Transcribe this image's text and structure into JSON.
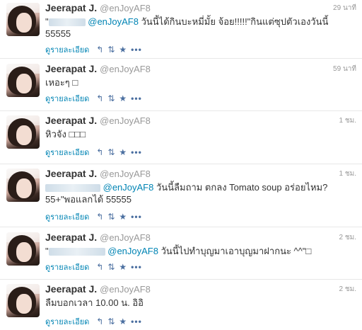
{
  "tweets": [
    {
      "name": "Jeerapat J.",
      "handle": "@enJoyAF8",
      "time": "29 นาที",
      "mention": "@enJoyAF8",
      "text_pre": "\"",
      "text": " วันนี้ได้กินบะหมี่มั้ย จ้อย!!!!!\"กินแต่ซุปตัวเองวันนี้ 55555",
      "details": "ดูรายละเอียด"
    },
    {
      "name": "Jeerapat J.",
      "handle": "@enJoyAF8",
      "time": "59 นาที",
      "text": "เหอะๆ □",
      "details": "ดูรายละเอียด"
    },
    {
      "name": "Jeerapat J.",
      "handle": "@enJoyAF8",
      "time": "1 ชม.",
      "text": "หิวจัง □□□",
      "details": "ดูรายละเอียด"
    },
    {
      "name": "Jeerapat J.",
      "handle": "@enJoyAF8",
      "time": "1 ชม.",
      "mention": "@enJoyAF8",
      "text": " วันนี้ลืมถาม ตกลง Tomato soup อร่อยไหม? 55+\"พอแลกได้ 55555",
      "details": "ดูรายละเอียด"
    },
    {
      "name": "Jeerapat J.",
      "handle": "@enJoyAF8",
      "time": "2 ชม.",
      "mention": "@enJoyAF8",
      "text_pre": "\"",
      "text": " วันนี้ไปทำบุญมาเอาบุญมาฝากนะ ^^\"□",
      "details": "ดูรายละเอียด"
    },
    {
      "name": "Jeerapat J.",
      "handle": "@enJoyAF8",
      "time": "2 ชม.",
      "text": "ลืมบอกเวลา 10.00 น. อิอิ",
      "details": "ดูรายละเอียด"
    }
  ],
  "icons": {
    "reply": "reply-icon",
    "retweet": "retweet-icon",
    "favorite": "star-icon",
    "more": "more-icon"
  },
  "colors": {
    "link": "#0084b4",
    "muted": "#999999",
    "text": "#333333"
  }
}
